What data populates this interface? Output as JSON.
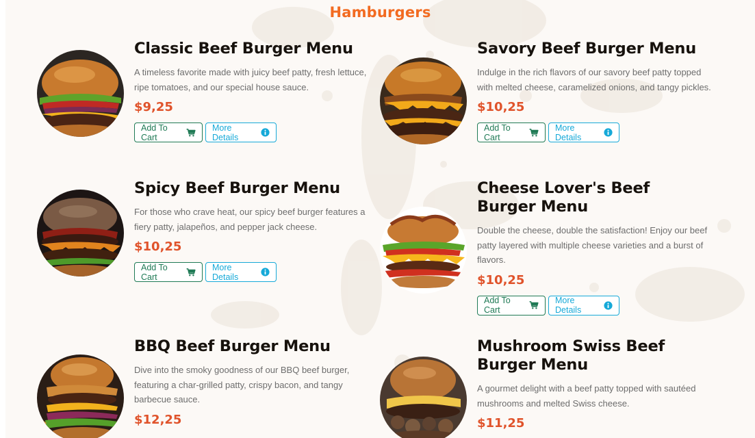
{
  "section": {
    "title": "Hamburgers"
  },
  "buttons": {
    "add_to_cart": "Add To Cart",
    "more_details": "More Details"
  },
  "colors": {
    "accent": "#f26b21",
    "price": "#e0532b",
    "cart": "#1f7a55",
    "details": "#16a9d8"
  },
  "icons": {
    "cart": "cart-icon",
    "details": "info-icon"
  },
  "menu": [
    {
      "name": "Classic Beef Burger Menu",
      "description": "A timeless favorite made with juicy beef patty, fresh lettuce, ripe tomatoes, and our special house sauce.",
      "price": "$9,25"
    },
    {
      "name": "Savory Beef Burger Menu",
      "description": "Indulge in the rich flavors of our savory beef patty topped with melted cheese, caramelized onions, and tangy pickles.",
      "price": "$10,25"
    },
    {
      "name": "Spicy Beef Burger Menu",
      "description": "For those who crave heat, our spicy beef burger features a fiery patty, jalapeños, and pepper jack cheese.",
      "price": "$10,25"
    },
    {
      "name": "Cheese Lover's Beef Burger Menu",
      "description": "Double the cheese, double the satisfaction! Enjoy our beef patty layered with multiple cheese varieties and a burst of flavors.",
      "price": "$10,25"
    },
    {
      "name": "BBQ Beef Burger Menu",
      "description": "Dive into the smoky goodness of our BBQ beef burger, featuring a char-grilled patty, crispy bacon, and tangy barbecue sauce.",
      "price": "$12,25"
    },
    {
      "name": "Mushroom Swiss Beef Burger Menu",
      "description": "A gourmet delight with a beef patty topped with sautéed mushrooms and melted Swiss cheese.",
      "price": "$11,25"
    }
  ]
}
